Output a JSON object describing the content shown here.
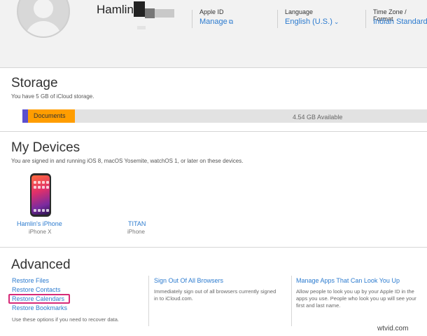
{
  "header": {
    "username": "Hamlin",
    "apple_id": {
      "label": "Apple ID",
      "value": "Manage"
    },
    "language": {
      "label": "Language",
      "value": "English (U.S.)"
    },
    "timezone": {
      "label": "Time Zone / Format",
      "value": "Indian Standard"
    }
  },
  "storage": {
    "title": "Storage",
    "subtitle": "You have 5 GB of iCloud storage.",
    "bar_label": "Documents",
    "available": "4.54 GB Available",
    "colors": {
      "documents": "#ff9d00",
      "other": "#5b4fcf",
      "free": "#e2e2e2"
    }
  },
  "devices": {
    "title": "My Devices",
    "subtitle": "You are signed in and running iOS 8, macOS Yosemite, watchOS 1, or later on these devices.",
    "items": [
      {
        "name": "Hamlin's iPhone",
        "model": "iPhone X"
      },
      {
        "name": "TITAN",
        "model": "iPhone"
      }
    ]
  },
  "advanced": {
    "title": "Advanced",
    "restore_links": [
      "Restore Files",
      "Restore Contacts",
      "Restore Calendars",
      "Restore Bookmarks"
    ],
    "restore_note": "Use these options if you need to recover data.",
    "signout": {
      "title": "Sign Out Of All Browsers",
      "desc": "Immediately sign out of all browsers currently signed in to iCloud.com."
    },
    "manage_apps": {
      "title": "Manage Apps That Can Look You Up",
      "desc": "Allow people to look you up by your Apple ID in the apps you use. People who look you up will see your first and last name."
    }
  },
  "watermark": "wtvid.com",
  "accent_color": "#2c7bcf",
  "highlight_color": "#d62a78"
}
